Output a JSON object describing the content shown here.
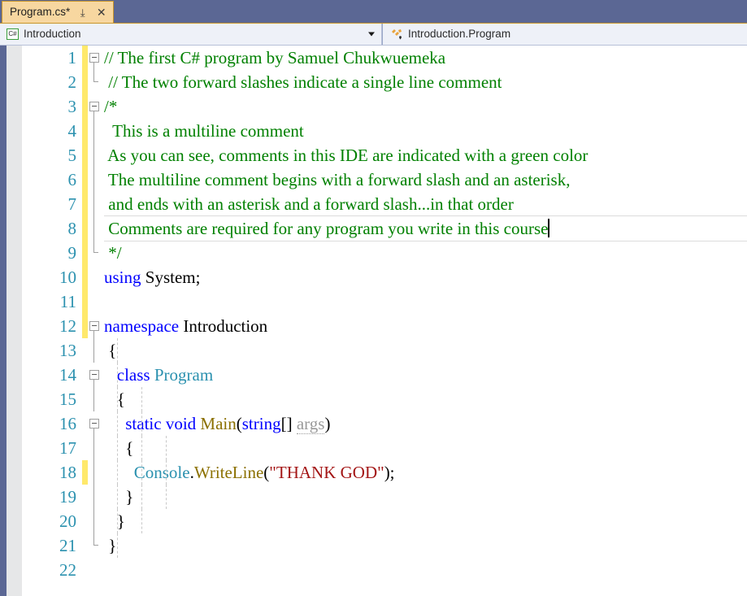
{
  "tab": {
    "title": "Program.cs*",
    "pin_icon": "pin-icon",
    "close_icon": "close-icon",
    "close_glyph": "✕",
    "pin_glyph": "⤓"
  },
  "nav_bar": {
    "type_icon_label": "C#",
    "type_name": "Introduction",
    "member_name": "Introduction.Program"
  },
  "editor": {
    "lines": [
      {
        "n": "1",
        "changed": true,
        "fold": "box",
        "guides": 0,
        "text": "// The first C# program by Samuel Chukwuemeka",
        "cls": "cmt"
      },
      {
        "n": "2",
        "changed": true,
        "fold": "end",
        "guides": 0,
        "text": " // The two forward slashes indicate a single line comment",
        "cls": "cmt"
      },
      {
        "n": "3",
        "changed": true,
        "fold": "box",
        "guides": 0,
        "text": "/*",
        "cls": "cmt"
      },
      {
        "n": "4",
        "changed": true,
        "fold": "full",
        "guides": 0,
        "text": "  This is a multiline comment",
        "cls": "cmt"
      },
      {
        "n": "5",
        "changed": true,
        "fold": "full",
        "guides": 0,
        "text": " As you can see, comments in this IDE are indicated with a green color",
        "cls": "cmt"
      },
      {
        "n": "6",
        "changed": true,
        "fold": "full",
        "guides": 0,
        "text": " The multiline comment begins with a forward slash and an asterisk,",
        "cls": "cmt"
      },
      {
        "n": "7",
        "changed": true,
        "fold": "full",
        "guides": 0,
        "text": " and ends with an asterisk and a forward slash...in that order",
        "cls": "cmt"
      },
      {
        "n": "8",
        "changed": true,
        "fold": "full",
        "guides": 0,
        "text": " Comments are required for any program you write in this course",
        "cls": "cmt",
        "current": true,
        "caret": true
      },
      {
        "n": "9",
        "changed": true,
        "fold": "end",
        "guides": 0,
        "text": " */",
        "cls": "cmt"
      },
      {
        "n": "10",
        "changed": true,
        "fold": "none",
        "guides": 0,
        "text": "",
        "cls": "pln",
        "tokens": [
          {
            "t": "using",
            "c": "kw"
          },
          {
            "t": " System;",
            "c": "pln"
          }
        ]
      },
      {
        "n": "11",
        "changed": true,
        "fold": "none",
        "guides": 0,
        "text": "",
        "cls": "pln"
      },
      {
        "n": "12",
        "changed": true,
        "fold": "box",
        "guides": 0,
        "text": "",
        "cls": "pln",
        "tokens": [
          {
            "t": "namespace",
            "c": "kw"
          },
          {
            "t": " Introduction",
            "c": "pln"
          }
        ]
      },
      {
        "n": "13",
        "changed": false,
        "fold": "full",
        "guides": 1,
        "text": " {",
        "cls": "pln"
      },
      {
        "n": "14",
        "changed": false,
        "fold": "box-line",
        "guides": 1,
        "text": "",
        "cls": "pln",
        "tokens": [
          {
            "t": "   ",
            "c": "pln"
          },
          {
            "t": "class",
            "c": "kw"
          },
          {
            "t": " ",
            "c": "pln"
          },
          {
            "t": "Program",
            "c": "typ"
          }
        ]
      },
      {
        "n": "15",
        "changed": false,
        "fold": "full",
        "guides": 2,
        "text": "   {",
        "cls": "pln"
      },
      {
        "n": "16",
        "changed": false,
        "fold": "box-line",
        "guides": 2,
        "text": "",
        "cls": "pln",
        "tokens": [
          {
            "t": "     ",
            "c": "pln"
          },
          {
            "t": "static void",
            "c": "kw"
          },
          {
            "t": " ",
            "c": "pln"
          },
          {
            "t": "Main",
            "c": "mth"
          },
          {
            "t": "(",
            "c": "pln"
          },
          {
            "t": "string",
            "c": "kw"
          },
          {
            "t": "[] ",
            "c": "pln"
          },
          {
            "t": "args",
            "c": "prm"
          },
          {
            "t": ")",
            "c": "pln"
          }
        ]
      },
      {
        "n": "17",
        "changed": false,
        "fold": "full",
        "guides": 3,
        "text": "     {",
        "cls": "pln"
      },
      {
        "n": "18",
        "changed": true,
        "fold": "full",
        "guides": 3,
        "text": "",
        "cls": "pln",
        "tokens": [
          {
            "t": "       ",
            "c": "pln"
          },
          {
            "t": "Console",
            "c": "typ"
          },
          {
            "t": ".",
            "c": "pln"
          },
          {
            "t": "WriteLine",
            "c": "mth"
          },
          {
            "t": "(",
            "c": "pln"
          },
          {
            "t": "\"THANK GOD\"",
            "c": "str"
          },
          {
            "t": ");",
            "c": "pln"
          }
        ]
      },
      {
        "n": "19",
        "changed": false,
        "fold": "full",
        "guides": 3,
        "text": "     }",
        "cls": "pln"
      },
      {
        "n": "20",
        "changed": false,
        "fold": "upper-tick",
        "guides": 2,
        "text": "   }",
        "cls": "pln"
      },
      {
        "n": "21",
        "changed": false,
        "fold": "end",
        "guides": 1,
        "text": " }",
        "cls": "pln"
      },
      {
        "n": "22",
        "changed": false,
        "fold": "none",
        "guides": 0,
        "text": "",
        "cls": "pln"
      }
    ]
  },
  "colors": {
    "tab_active_bg": "#f7d7a0",
    "tab_border": "#c8952a",
    "tab_strip_bg": "#5b6794",
    "nav_bar_bg": "#eef1f8",
    "indicator_band": "#5b6794",
    "breakpoint_margin": "#e6e7e8",
    "line_number": "#2b91af",
    "change_bar": "#ffe96b",
    "comment": "#008000",
    "keyword": "#0000ff",
    "type": "#2b91af",
    "method": "#8b7000",
    "string": "#a31515",
    "parameter": "#9a9a9a"
  }
}
